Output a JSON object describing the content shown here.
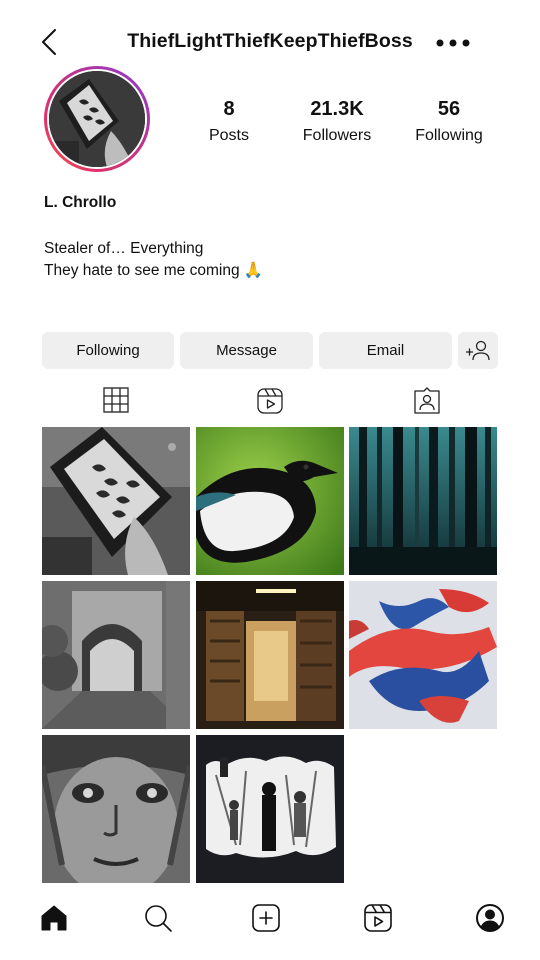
{
  "header": {
    "username": "ThiefLightThiefKeepThiefBoss"
  },
  "profile": {
    "display_name": "L. Chrollo",
    "bio_line_1": "Stealer of… Everything",
    "bio_line_2": "They hate to see me coming 🙏",
    "stats": {
      "posts_count": "8",
      "posts_label": "Posts",
      "followers_count": "21.3K",
      "followers_label": "Followers",
      "following_count": "56",
      "following_label": "Following"
    }
  },
  "actions": {
    "following_label": "Following",
    "message_label": "Message",
    "email_label": "Email"
  },
  "icons": {
    "back": "chevron-left-icon",
    "more": "more-horizontal-icon",
    "add_user": "add-user-icon",
    "grid_tab": "grid-icon",
    "reels_tab": "reels-icon",
    "tagged_tab": "tagged-icon",
    "home": "home-icon",
    "search": "search-icon",
    "create": "create-icon",
    "reels": "reels-icon",
    "profile": "profile-icon"
  },
  "colors": {
    "button_bg": "#efefef",
    "text": "#111111",
    "ring_gradient_start": "#8a3bd6",
    "ring_gradient_end": "#f56040"
  }
}
